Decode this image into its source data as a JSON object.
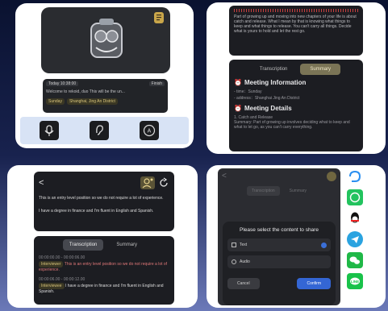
{
  "colors": {
    "accent_gold": "#c9a64a",
    "dark_panel": "#1c1d22",
    "card_bg": "#ffffff"
  },
  "panel1": {
    "badge_left": "Today 10:38:00",
    "badge_right": "Finish",
    "welcome_text": "Welcome to rekoid, duo This will be the un...",
    "chip_a": "Sunday",
    "chip_b": "Shanghai, Jing An District",
    "action_icons": [
      "microphone-icon",
      "ear-icon",
      "translate-icon"
    ]
  },
  "panel2": {
    "top_text": "Part of growing up and moving into new chapters of your life is about catch and release. What I mean by that is knowing what things to keep and what things to release. You can't carry all things. Decide what is yours to hold and let the rest go.",
    "tab_transcription": "Transcription",
    "tab_summary": "Summary",
    "meeting_info_heading": "Meeting Information",
    "time_line": "- time：Sunday",
    "address_line": "- address：Shanghai Jing An District",
    "meeting_details_heading": "Meeting Details",
    "detail_title": "1. Catch and Release",
    "detail_text": "Summary: Part of growing up involves deciding what to keep and what to let go, as you can't carry everything."
  },
  "panel3": {
    "line1": "This is an entry level position so we do not require a lot of experience.",
    "line2": "I have a degree in finance and I'm fluent in English and Spanish.",
    "tab_transcription": "Transcription",
    "tab_summary": "Summary",
    "t1_time": "00:00:00.00 - 00:00:06.00",
    "t1_tag": "Interviewer",
    "t1_text": "This is an entry level position so we do not require a lot of experience.",
    "t2_time": "00:00:06.00 - 00:00:12.00",
    "t2_tag": "Interviewee",
    "t2_text": "I have a degree in finance and I'm fluent in English and Spanish."
  },
  "panel4": {
    "tab_transcription": "Transcription",
    "tab_summary": "Summary",
    "dialog_title": "Please select the content to share",
    "option_text": "Text",
    "option_audio": "Audio",
    "cancel_label": "Cancel",
    "confirm_label": "Confirm"
  },
  "share_apps": [
    "dingtalk-icon",
    "whatsapp-icon",
    "qq-icon",
    "telegram-icon",
    "wechat-icon",
    "line-icon"
  ]
}
